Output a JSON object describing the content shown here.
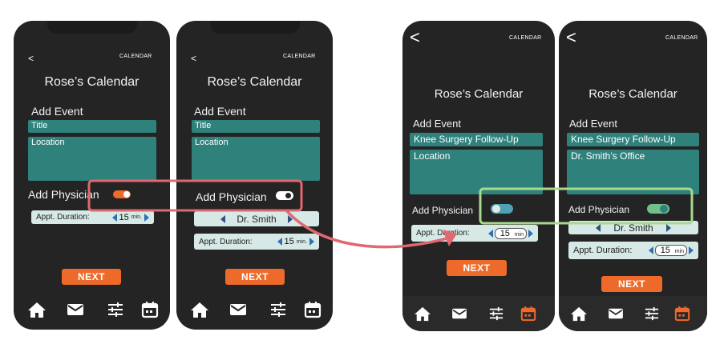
{
  "screens": [
    {
      "back": "<",
      "calendar_link": "CALENDAR",
      "title": "Rose’s Calendar",
      "add_event": "Add Event",
      "title_field": "Title",
      "location_field": "Location",
      "add_physician": "Add Physician",
      "toggle_on": true,
      "appt_label": "Appt. Duration:",
      "appt_value": "15",
      "appt_unit": "min.",
      "next": "NEXT"
    },
    {
      "back": "<",
      "calendar_link": "CALENDAR",
      "title": "Rose’s Calendar",
      "add_event": "Add Event",
      "title_field": "Title",
      "location_field": "Location",
      "add_physician": "Add Physician",
      "toggle_on": true,
      "physician_value": "Dr. Smith",
      "appt_label": "Appt. Duration:",
      "appt_value": "15",
      "appt_unit": "min.",
      "next": "NEXT"
    },
    {
      "back": "<",
      "calendar_link": "CALENDAR",
      "title": "Rose’s Calendar",
      "add_event": "Add Event",
      "title_field": "Knee Surgery Follow-Up",
      "location_field": "Location",
      "add_physician": "Add Physician",
      "toggle_on": false,
      "appt_label": "Appt. Duration:",
      "appt_value": "15",
      "appt_unit": "min",
      "next": "NEXT"
    },
    {
      "back": "<",
      "calendar_link": "CALENDAR",
      "title": "Rose’s Calendar",
      "add_event": "Add Event",
      "title_field": "Knee Surgery Follow-Up",
      "location_field": "Dr. Smith’s Office",
      "add_physician": "Add Physician",
      "toggle_on": true,
      "physician_value": "Dr. Smith",
      "appt_label": "Appt. Duration:",
      "appt_value": "15",
      "appt_unit": "min",
      "next": "NEXT"
    }
  ],
  "tabs": [
    "home-icon",
    "mail-icon",
    "sliders-icon",
    "calendar-icon"
  ],
  "colors": {
    "phone_bg": "#242424",
    "field_teal": "#2f827c",
    "pill_bg": "#d6e9e6",
    "accent_orange": "#ee6a2b",
    "toggle_on_orange": "#ee6a2b",
    "toggle_on_green": "#6fc08b",
    "toggle_off_teal": "#4fa2b3",
    "highlight_red": "#e06870",
    "highlight_green": "#a8d98d"
  }
}
